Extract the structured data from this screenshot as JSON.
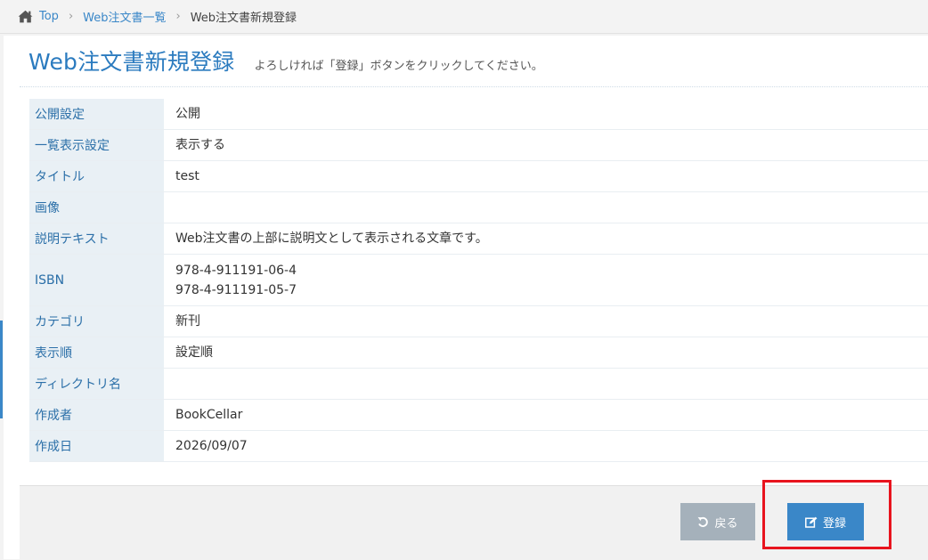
{
  "breadcrumb": {
    "items": [
      "Top",
      "Web注文書一覧"
    ],
    "current": "Web注文書新規登録"
  },
  "header": {
    "title": "Web注文書新規登録",
    "subtitle": "よろしければ「登録」ボタンをクリックしてください。"
  },
  "details": {
    "rows": [
      {
        "label": "公開設定",
        "value": "公開"
      },
      {
        "label": "一覧表示設定",
        "value": "表示する"
      },
      {
        "label": "タイトル",
        "value": "test"
      },
      {
        "label": "画像",
        "value": ""
      },
      {
        "label": "説明テキスト",
        "value": "Web注文書の上部に説明文として表示される文章です。"
      },
      {
        "label": "ISBN",
        "values": [
          "978-4-911191-06-4",
          "978-4-911191-05-7"
        ]
      },
      {
        "label": "カテゴリ",
        "value": "新刊"
      },
      {
        "label": "表示順",
        "value": "設定順"
      },
      {
        "label": "ディレクトリ名",
        "value": ""
      },
      {
        "label": "作成者",
        "value": "BookCellar"
      },
      {
        "label": "作成日",
        "value": "2026/09/07"
      }
    ]
  },
  "footer": {
    "back_label": "戻る",
    "register_label": "登録"
  },
  "icons": {
    "home": "home-icon",
    "back": "undo-icon",
    "register": "edit-icon"
  },
  "colors": {
    "accent": "#3a87c8",
    "title": "#2b7bbf",
    "label_bg": "#e9f0f5",
    "back_button": "#a5b1bb",
    "highlight": "#e8141e"
  }
}
